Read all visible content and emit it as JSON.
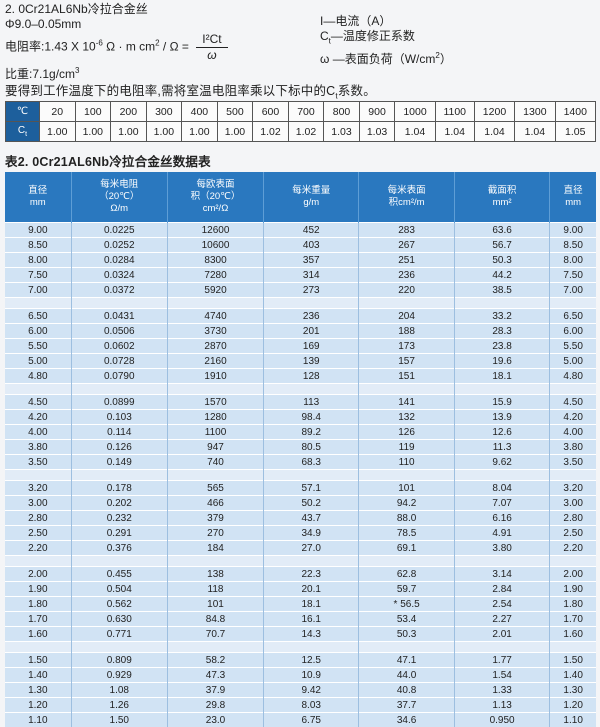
{
  "header": {
    "title": "2. 0Cr21AL6Nb冷拉合金丝",
    "range": "Φ9.0–0.05mm",
    "resistivity_prefix": "电阻率:1.43 X 10",
    "resistivity_exp": "-6",
    "resistivity_unit": " Ω · m  cm",
    "resistivity_unit_exp": "2",
    "resistivity_suffix": " / Ω =",
    "formula_numerator": "I²Ct",
    "formula_denominator": "ω",
    "density": "比重:7.1g/cm",
    "density_exp": "3"
  },
  "legend": {
    "current": "I—电流（A）",
    "correction_symbol": "C",
    "correction_sub": "t",
    "correction": "—温度修正系数",
    "load": "ω —表面负荷（W/cm",
    "load_exp": "2",
    "load_suffix": "）"
  },
  "note": "要得到工作温度下的电阻率,需将室温电阻率乘以下标中的C",
  "note_sub": "t",
  "note_suffix": "系数。",
  "correction_table": {
    "temp_label": "℃",
    "coef_label": "C",
    "coef_sub": "t",
    "temps": [
      "20",
      "100",
      "200",
      "300",
      "400",
      "500",
      "600",
      "700",
      "800",
      "900",
      "1000",
      "1100",
      "1200",
      "1300",
      "1400"
    ],
    "coefs": [
      "1.00",
      "1.00",
      "1.00",
      "1.00",
      "1.00",
      "1.00",
      "1.02",
      "1.02",
      "1.03",
      "1.03",
      "1.04",
      "1.04",
      "1.04",
      "1.04",
      "1.05"
    ]
  },
  "table2": {
    "title": "表2. 0Cr21AL6Nb冷拉合金丝数据表",
    "headers": [
      [
        "直径",
        "mm"
      ],
      [
        "每米电阻",
        "（20℃）",
        "Ω/m"
      ],
      [
        "每欧表面",
        "积（20℃）",
        "cm²/Ω"
      ],
      [
        "每米重量",
        "g/m"
      ],
      [
        "每米表面",
        "积cm²/m"
      ],
      [
        "截面积",
        "mm²"
      ],
      [
        "直径",
        "mm"
      ]
    ],
    "groups": [
      [
        [
          "9.00",
          "0.0225",
          "12600",
          "452",
          "283",
          "63.6",
          "9.00"
        ],
        [
          "8.50",
          "0.0252",
          "10600",
          "403",
          "267",
          "56.7",
          "8.50"
        ],
        [
          "8.00",
          "0.0284",
          "8300",
          "357",
          "251",
          "50.3",
          "8.00"
        ],
        [
          "7.50",
          "0.0324",
          "7280",
          "314",
          "236",
          "44.2",
          "7.50"
        ],
        [
          "7.00",
          "0.0372",
          "5920",
          "273",
          "220",
          "38.5",
          "7.00"
        ]
      ],
      [
        [
          "6.50",
          "0.0431",
          "4740",
          "236",
          "204",
          "33.2",
          "6.50"
        ],
        [
          "6.00",
          "0.0506",
          "3730",
          "201",
          "188",
          "28.3",
          "6.00"
        ],
        [
          "5.50",
          "0.0602",
          "2870",
          "169",
          "173",
          "23.8",
          "5.50"
        ],
        [
          "5.00",
          "0.0728",
          "2160",
          "139",
          "157",
          "19.6",
          "5.00"
        ],
        [
          "4.80",
          "0.0790",
          "1910",
          "128",
          "151",
          "18.1",
          "4.80"
        ]
      ],
      [
        [
          "4.50",
          "0.0899",
          "1570",
          "113",
          "141",
          "15.9",
          "4.50"
        ],
        [
          "4.20",
          "0.103",
          "1280",
          "98.4",
          "132",
          "13.9",
          "4.20"
        ],
        [
          "4.00",
          "0.114",
          "1100",
          "89.2",
          "126",
          "12.6",
          "4.00"
        ],
        [
          "3.80",
          "0.126",
          "947",
          "80.5",
          "119",
          "11.3",
          "3.80"
        ],
        [
          "3.50",
          "0.149",
          "740",
          "68.3",
          "110",
          "9.62",
          "3.50"
        ]
      ],
      [
        [
          "3.20",
          "0.178",
          "565",
          "57.1",
          "101",
          "8.04",
          "3.20"
        ],
        [
          "3.00",
          "0.202",
          "466",
          "50.2",
          "94.2",
          "7.07",
          "3.00"
        ],
        [
          "2.80",
          "0.232",
          "379",
          "43.7",
          "88.0",
          "6.16",
          "2.80"
        ],
        [
          "2.50",
          "0.291",
          "270",
          "34.9",
          "78.5",
          "4.91",
          "2.50"
        ],
        [
          "2.20",
          "0.376",
          "184",
          "27.0",
          "69.1",
          "3.80",
          "2.20"
        ]
      ],
      [
        [
          "2.00",
          "0.455",
          "138",
          "22.3",
          "62.8",
          "3.14",
          "2.00"
        ],
        [
          "1.90",
          "0.504",
          "118",
          "20.1",
          "59.7",
          "2.84",
          "1.90"
        ],
        [
          "1.80",
          "0.562",
          "101",
          "18.1",
          "* 56.5",
          "2.54",
          "1.80"
        ],
        [
          "1.70",
          "0.630",
          "84.8",
          "16.1",
          "53.4",
          "2.27",
          "1.70"
        ],
        [
          "1.60",
          "0.771",
          "70.7",
          "14.3",
          "50.3",
          "2.01",
          "1.60"
        ]
      ],
      [
        [
          "1.50",
          "0.809",
          "58.2",
          "12.5",
          "47.1",
          "1.77",
          "1.50"
        ],
        [
          "1.40",
          "0.929",
          "47.3",
          "10.9",
          "44.0",
          "1.54",
          "1.40"
        ],
        [
          "1.30",
          "1.08",
          "37.9",
          "9.42",
          "40.8",
          "1.33",
          "1.30"
        ],
        [
          "1.20",
          "1.26",
          "29.8",
          "8.03",
          "37.7",
          "1.13",
          "1.20"
        ],
        [
          "1.10",
          "1.50",
          "23.0",
          "6.75",
          "34.6",
          "0.950",
          "1.10"
        ]
      ]
    ]
  }
}
